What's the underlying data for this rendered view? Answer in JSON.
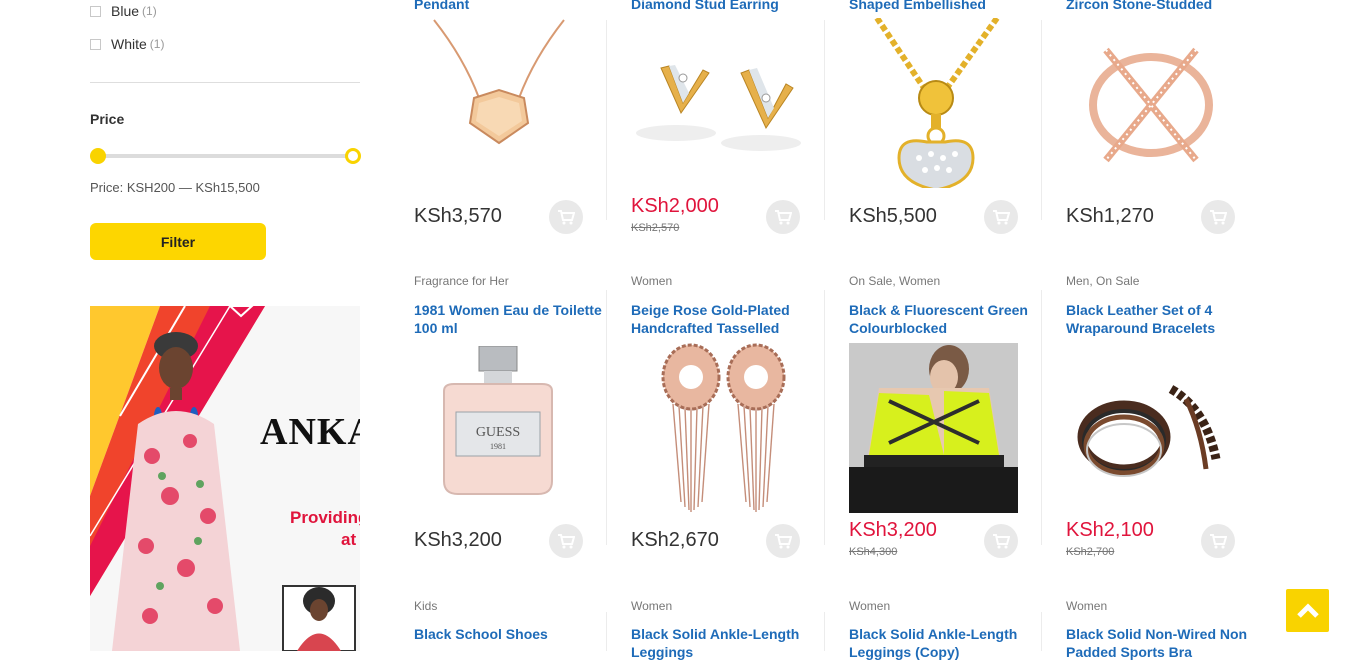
{
  "sidebar": {
    "color_filters": [
      {
        "label": "Blue",
        "count": "(1)"
      },
      {
        "label": "White",
        "count": "(1)"
      }
    ],
    "price": {
      "heading": "Price",
      "range_text": "Price: KSH200 — KSh15,500",
      "min_fraction": 0,
      "max_fraction": 1,
      "filter_label": "Filter"
    },
    "banner": {
      "brand": "ANKA",
      "tagline_line1": "Providing",
      "tagline_line2": "at"
    }
  },
  "products_row1": [
    {
      "title": "Pendant",
      "price": "KSh3,570",
      "old_price": "",
      "sale": false
    },
    {
      "title": "Diamond Stud Earring",
      "price": "KSh2,000",
      "old_price": "KSh2,570",
      "sale": true
    },
    {
      "title": "Shaped Embellished",
      "price": "KSh5,500",
      "old_price": "",
      "sale": false
    },
    {
      "title": "Zircon Stone-Studded",
      "price": "KSh1,270",
      "old_price": "",
      "sale": false
    }
  ],
  "products_row2": [
    {
      "category": "Fragrance for Her",
      "title": "1981 Women Eau de Toilette 100 ml",
      "price": "KSh3,200",
      "old_price": "",
      "sale": false
    },
    {
      "category": "Women",
      "title": "Beige Rose Gold-Plated Handcrafted Tasselled",
      "price": "KSh2,670",
      "old_price": "",
      "sale": false
    },
    {
      "category": "On Sale, Women",
      "title": "Black & Fluorescent Green Colourblocked",
      "price": "KSh3,200",
      "old_price": "KSh4,300",
      "sale": true
    },
    {
      "category": "Men, On Sale",
      "title": "Black Leather Set of 4 Wraparound Bracelets",
      "price": "KSh2,100",
      "old_price": "KSh2,700",
      "sale": true
    }
  ],
  "products_row3": [
    {
      "category": "Kids",
      "title": "Black School Shoes"
    },
    {
      "category": "Women",
      "title": "Black Solid Ankle-Length Leggings"
    },
    {
      "category": "Women",
      "title": "Black Solid Ankle-Length Leggings (Copy)"
    },
    {
      "category": "Women",
      "title": "Black Solid Non-Wired Non Padded Sports Bra"
    }
  ],
  "perfume_brand": "GUESS",
  "perfume_sub": "1981",
  "icons": {
    "cart": "add-to-cart-icon",
    "back_to_top": "chevron-up-icon"
  },
  "colors": {
    "accent": "#fdd600",
    "link": "#1e6bb8",
    "sale": "#e0143c"
  }
}
